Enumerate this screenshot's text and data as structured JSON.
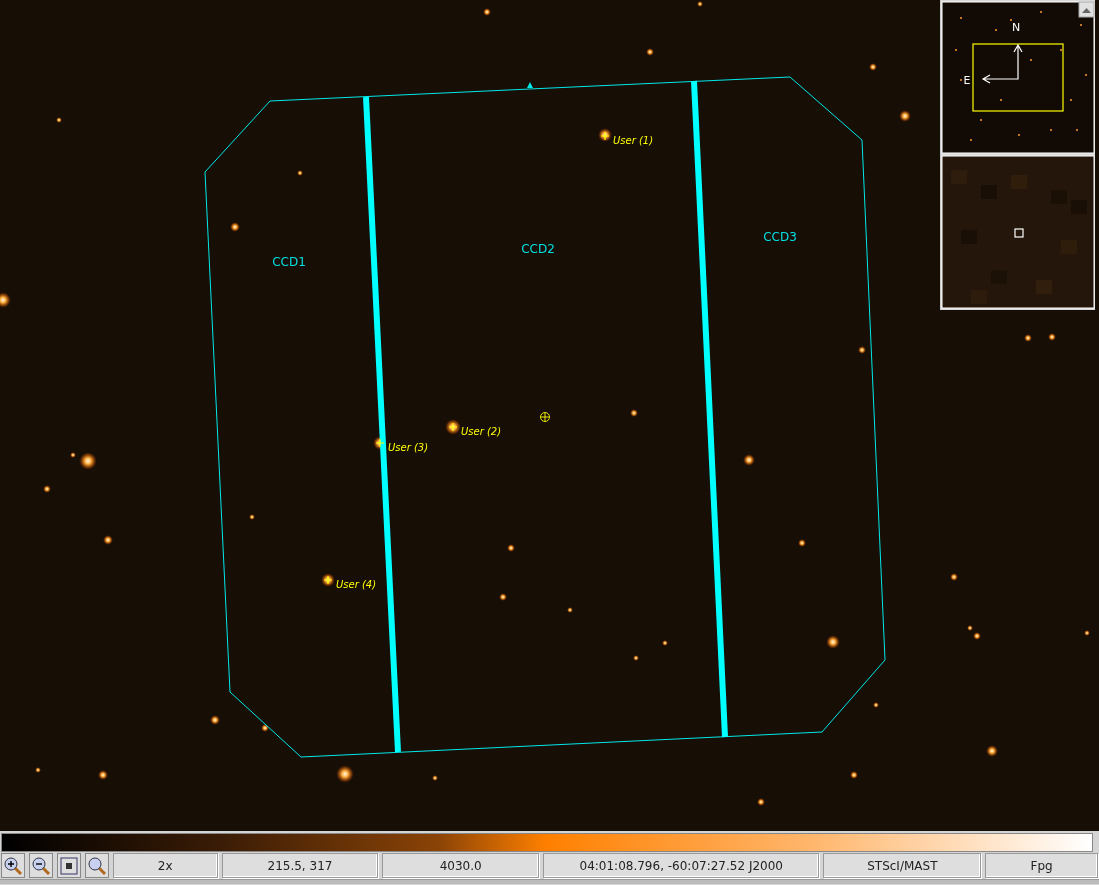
{
  "footprint": {
    "ccds": [
      {
        "label": "CCD1"
      },
      {
        "label": "CCD2"
      },
      {
        "label": "CCD3"
      }
    ]
  },
  "targets": [
    {
      "label": "User (1)"
    },
    {
      "label": "User (2)"
    },
    {
      "label": "User (3)"
    },
    {
      "label": "User (4)"
    }
  ],
  "overview": {
    "north_label": "N",
    "east_label": "E"
  },
  "status_bar": {
    "zoom": "2x",
    "pixel": "215.5, 317",
    "value": "4030.0",
    "coordinates": "04:01:08.796, -60:07:27.52 J2000",
    "source": "STScI/MAST",
    "format": "Fpg"
  }
}
